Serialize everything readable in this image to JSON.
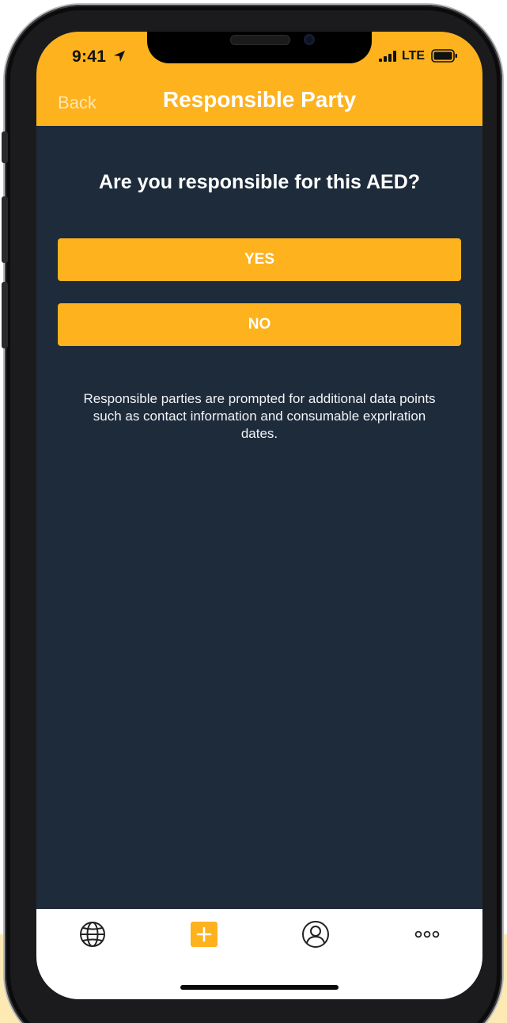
{
  "status_bar": {
    "time": "9:41",
    "network": "LTE",
    "icons": [
      "location-arrow-icon",
      "signal-bars-icon",
      "battery-icon"
    ]
  },
  "nav": {
    "back_label": "Back",
    "title": "Responsible Party"
  },
  "main": {
    "question": "Are you responsible for this AED?",
    "yes_label": "YES",
    "no_label": "NO",
    "info": "Responsible parties are prompted for additional data points such as contact information and consumable exprlration dates."
  },
  "tab_bar": {
    "items": [
      {
        "icon": "globe-icon"
      },
      {
        "icon": "add-icon"
      },
      {
        "icon": "profile-icon"
      },
      {
        "icon": "more-icon"
      }
    ]
  },
  "colors": {
    "accent": "#fdb21e",
    "background": "#1e2b3b",
    "tab_bar": "#ffffff"
  }
}
